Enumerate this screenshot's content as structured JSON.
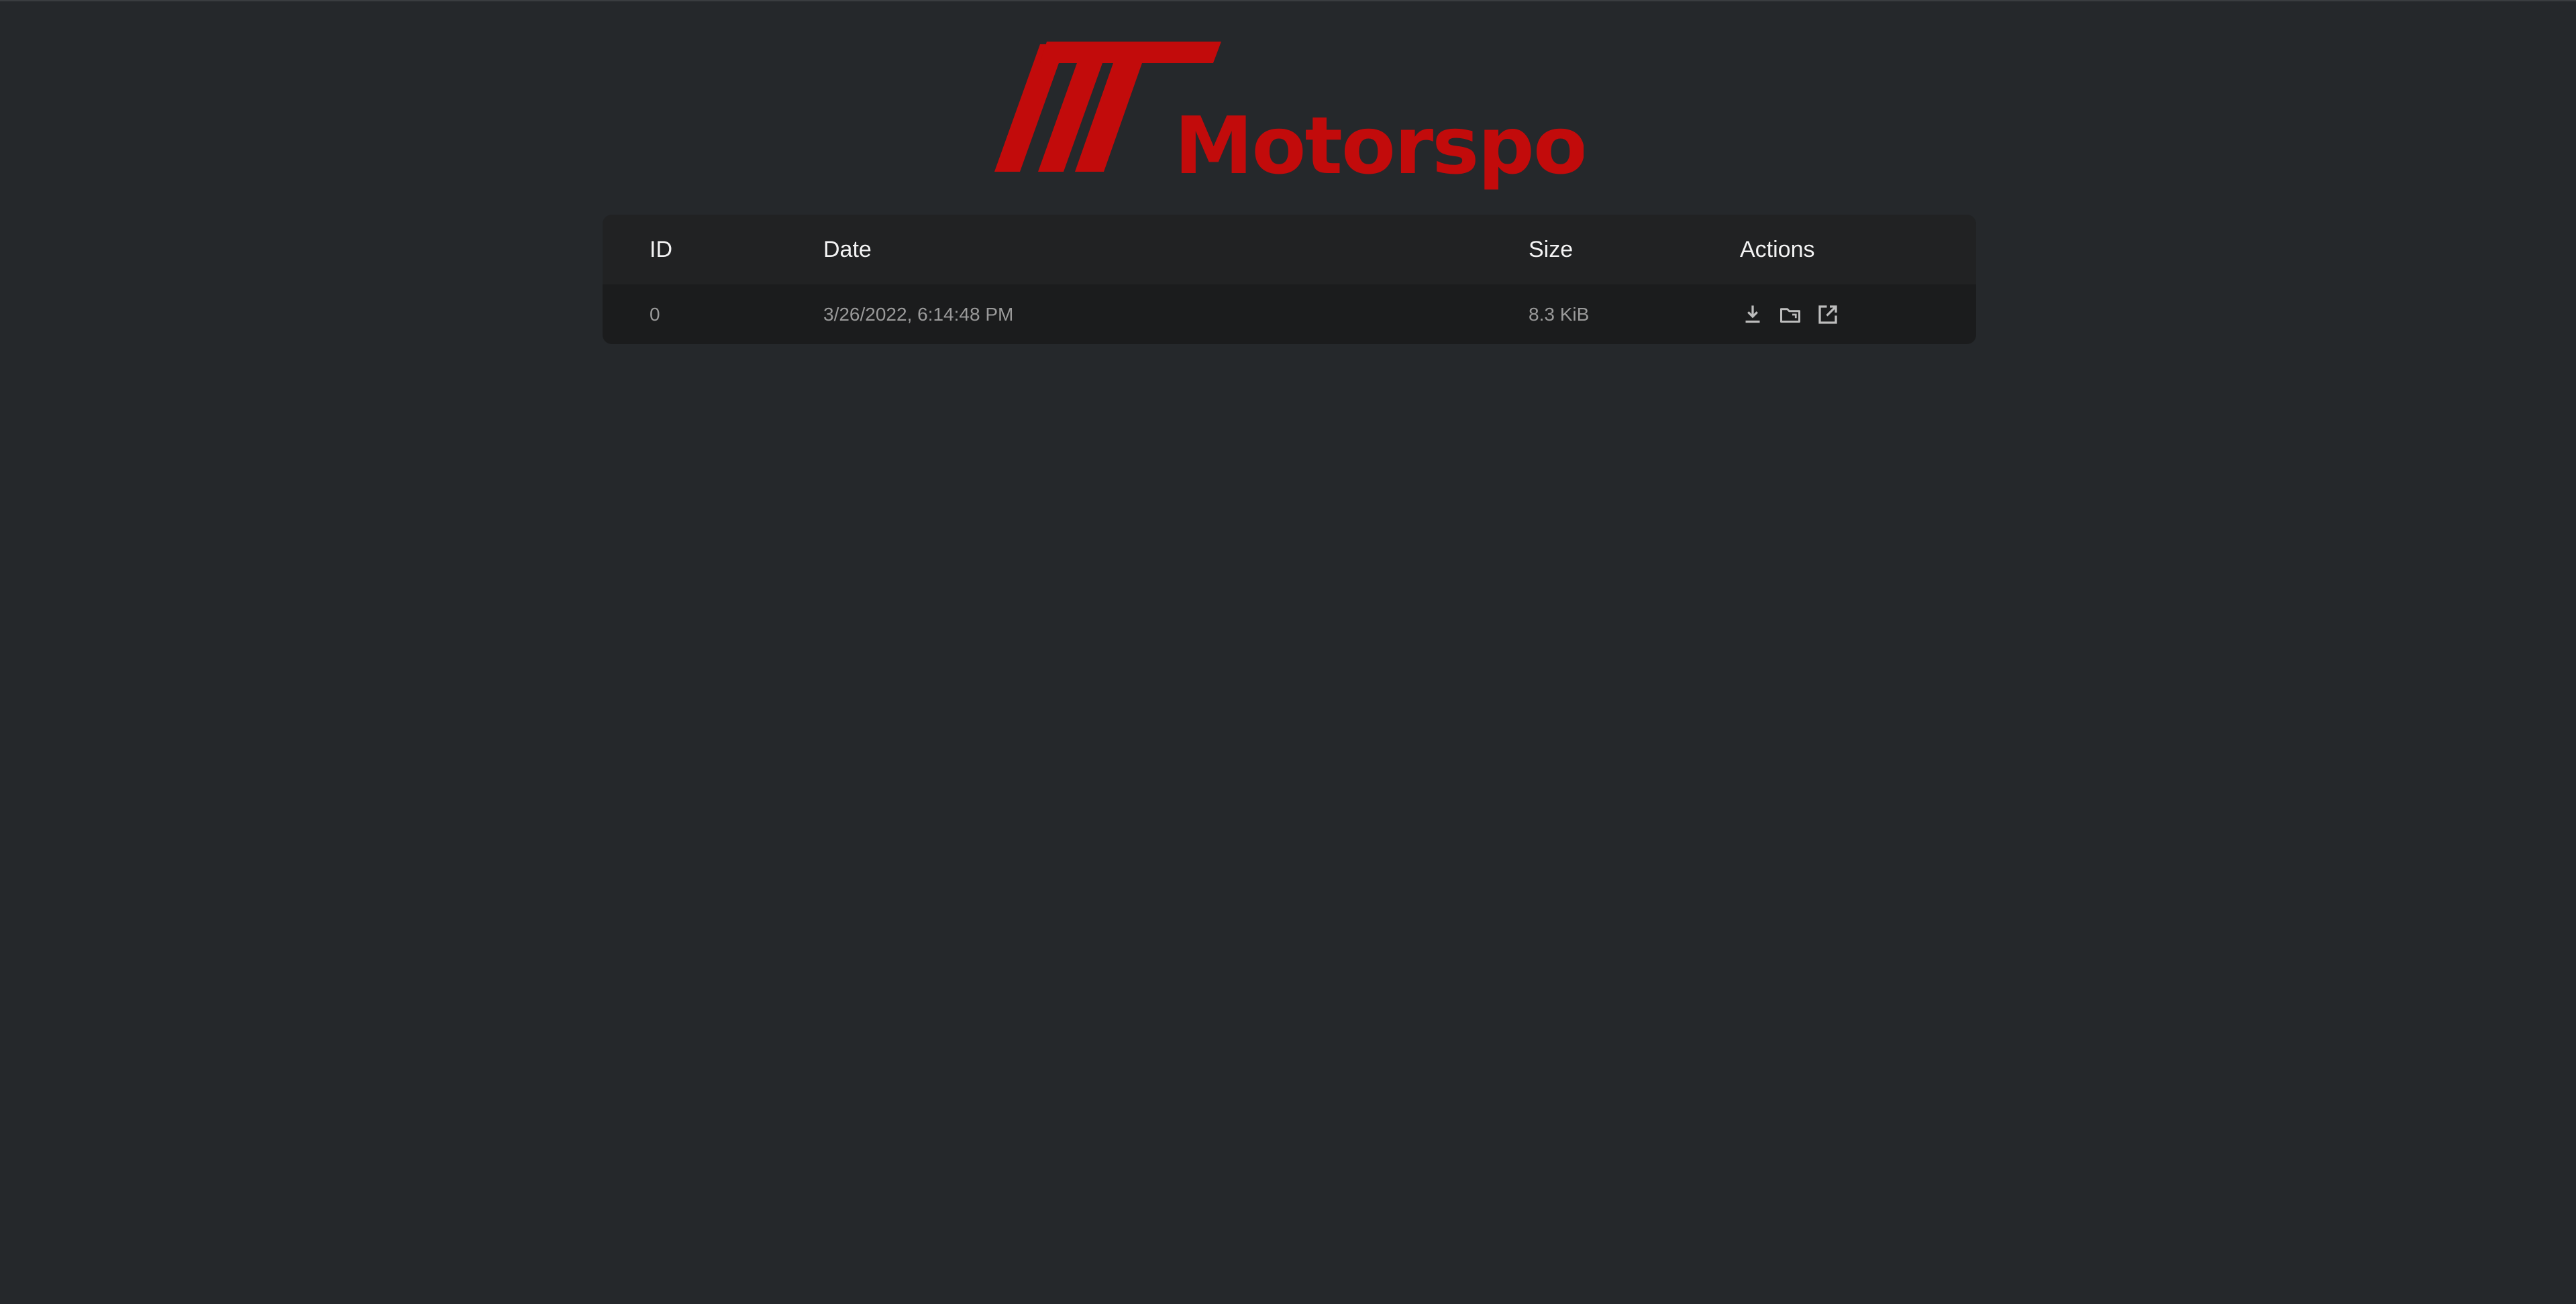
{
  "brand": {
    "name": "Motorsports",
    "accent": "#c20b0b"
  },
  "table": {
    "headers": {
      "id": "ID",
      "date": "Date",
      "size": "Size",
      "actions": "Actions"
    },
    "rows": [
      {
        "id": "0",
        "date": "3/26/2022, 6:14:48 PM",
        "size": "8.3 KiB",
        "actions": [
          "download-icon",
          "folder-icon",
          "open-external-icon"
        ]
      }
    ]
  },
  "colors": {
    "background": "#25282b",
    "panel": "#1f2022",
    "header_text": "#f3f3f3",
    "cell_text": "#9a9a9a",
    "icon": "#bdbdbd"
  }
}
